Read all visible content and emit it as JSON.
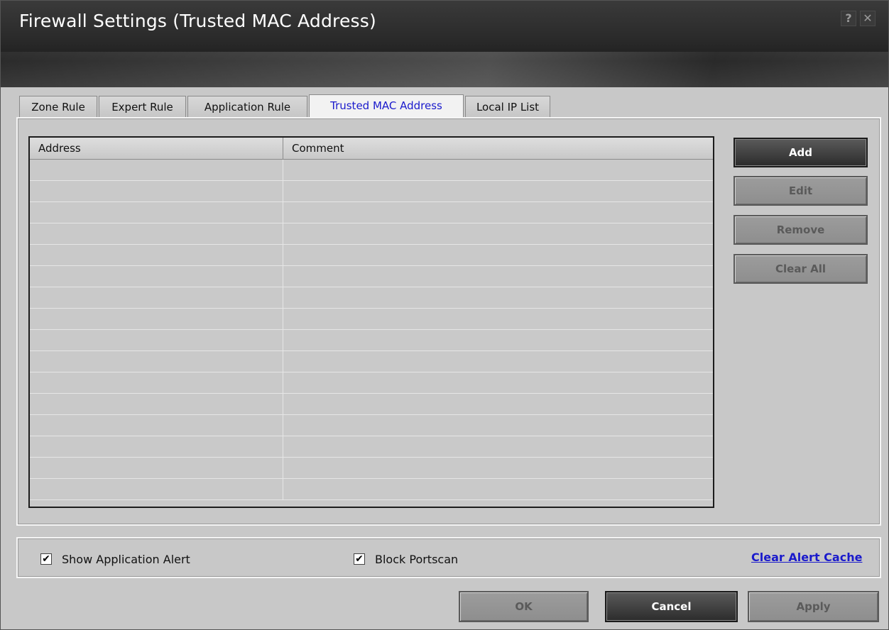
{
  "window": {
    "title": "Firewall Settings (Trusted MAC Address)",
    "help_glyph": "?",
    "close_glyph": "✕"
  },
  "tabs": [
    {
      "label": "Zone Rule",
      "active": false
    },
    {
      "label": "Expert Rule",
      "active": false
    },
    {
      "label": "Application Rule",
      "active": false
    },
    {
      "label": "Trusted MAC Address",
      "active": true
    },
    {
      "label": "Local IP List",
      "active": false
    }
  ],
  "table": {
    "columns": [
      "Address",
      "Comment"
    ],
    "rows": []
  },
  "side_buttons": {
    "add": "Add",
    "edit": "Edit",
    "remove": "Remove",
    "clear_all": "Clear All"
  },
  "options": {
    "show_application_alert": {
      "label": "Show Application Alert",
      "checked": true
    },
    "block_portscan": {
      "label": "Block Portscan",
      "checked": true
    },
    "clear_alert_cache": "Clear Alert Cache"
  },
  "footer": {
    "ok": "OK",
    "cancel": "Cancel",
    "apply": "Apply"
  },
  "check_glyph": "✔"
}
